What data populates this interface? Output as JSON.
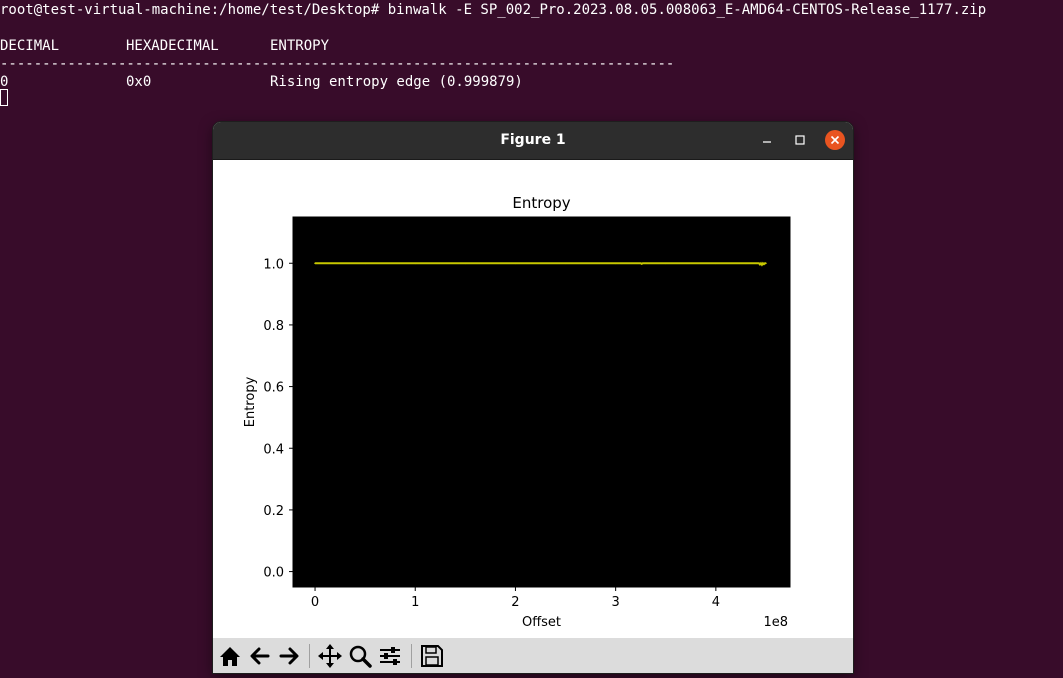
{
  "terminal": {
    "command": "root@test-virtual-machine:/home/test/Desktop# binwalk -E SP_002_Pro.2023.08.05.008063_E-AMD64-CENTOS-Release_1177.zip",
    "headers": [
      "DECIMAL",
      "HEXADECIMAL",
      "ENTROPY"
    ],
    "separator": "--------------------------------------------------------------------------------",
    "row": {
      "decimal": "0",
      "hex": "0x0",
      "entropy": "Rising entropy edge (0.999879)"
    }
  },
  "window": {
    "title": "Figure 1",
    "controls": [
      "minimize-icon",
      "maximize-icon",
      "close-icon"
    ]
  },
  "toolbar": {
    "buttons": [
      "home-icon",
      "back-arrow-icon",
      "forward-arrow-icon",
      "pan-icon",
      "zoom-icon",
      "configure-subplots-icon",
      "save-icon"
    ]
  },
  "colors": {
    "terminal_bg": "#380c2a",
    "plot_bg": "#000000",
    "series": "#c8c800",
    "close_button": "#e95420"
  },
  "chart_data": {
    "type": "line",
    "title": "Entropy",
    "xlabel": "Offset",
    "ylabel": "Entropy",
    "x_offset_text": "1e8",
    "xlim": [
      -0.22,
      4.74
    ],
    "ylim": [
      -0.05,
      1.15
    ],
    "xticks": [
      0,
      1,
      2,
      3,
      4
    ],
    "yticks": [
      0.0,
      0.2,
      0.4,
      0.6,
      0.8,
      1.0
    ],
    "xtick_labels": [
      "0",
      "1",
      "2",
      "3",
      "4"
    ],
    "ytick_labels": [
      "0.0",
      "0.2",
      "0.4",
      "0.6",
      "0.8",
      "1.0"
    ],
    "grid": false,
    "series": [
      {
        "x": [
          0,
          0.5,
          1.0,
          1.5,
          2.0,
          2.5,
          3.0,
          3.25,
          3.26,
          3.27,
          3.5,
          4.0,
          4.3,
          4.43,
          4.44,
          4.45,
          4.46,
          4.47,
          4.48,
          4.49,
          4.5
        ],
        "y": [
          0.9999,
          0.9999,
          0.9999,
          0.9999,
          0.9999,
          0.9999,
          0.9999,
          0.9999,
          0.998,
          0.9999,
          0.9999,
          0.9999,
          0.9999,
          0.9999,
          0.996,
          0.9999,
          0.995,
          0.9999,
          0.997,
          0.9999,
          0.9999
        ]
      }
    ]
  }
}
